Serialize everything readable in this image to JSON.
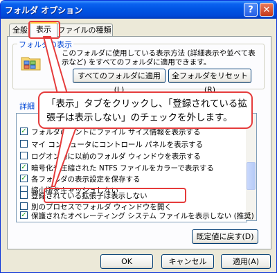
{
  "window": {
    "title": "フォルダ オプション",
    "help_label": "?",
    "close_label": "✕"
  },
  "tabs": [
    {
      "label": "全般"
    },
    {
      "label": "表示"
    },
    {
      "label": "ファイルの種類"
    }
  ],
  "folder_view": {
    "group_label": "フォルダの表示",
    "description": "このフォルダに使用している表示方法 (詳細表示や並べて表示など) をすべてのフォルダに適用できます。",
    "apply_all_label": "すべてのフォルダに適用(L)",
    "reset_all_label": "全フォルダをリセット(R)"
  },
  "advanced": {
    "group_label": "詳細",
    "items": [
      {
        "label": "フォルダのヒントにファイル サイズ情報を表示する",
        "checked": true
      },
      {
        "label": "マイ コンピュータにコントロール パネルを表示する",
        "checked": false
      },
      {
        "label": "ログオン時に以前のフォルダ ウィンドウを表示する",
        "checked": false
      },
      {
        "label": "暗号化や圧縮された NTFS ファイルをカラーで表示する",
        "checked": true
      },
      {
        "label": "各フォルダの表示設定を保存する",
        "checked": true
      },
      {
        "label": "縮小版をキャッシュしない",
        "checked": false
      },
      {
        "label": "登録されている拡張子は表示しない",
        "checked": false
      },
      {
        "label": "別のプロセスでフォルダ ウィンドウを開く",
        "checked": false
      },
      {
        "label": "保護されたオペレーティング システム ファイルを表示しない (推奨)",
        "checked": true
      }
    ],
    "restore_defaults_label": "既定値に戻す(D)"
  },
  "footer": {
    "ok_label": "OK",
    "cancel_label": "キャンセル",
    "apply_label": "適用(A)"
  },
  "callout": {
    "text": "「表示」タブをクリックし、「登録されている拡張子は表示しない」のチェックを外します。"
  },
  "colors": {
    "title_bar": "#0054e3",
    "highlight": "#e53b3b",
    "panel": "#fcfcfe",
    "dialog": "#ece9d8"
  }
}
